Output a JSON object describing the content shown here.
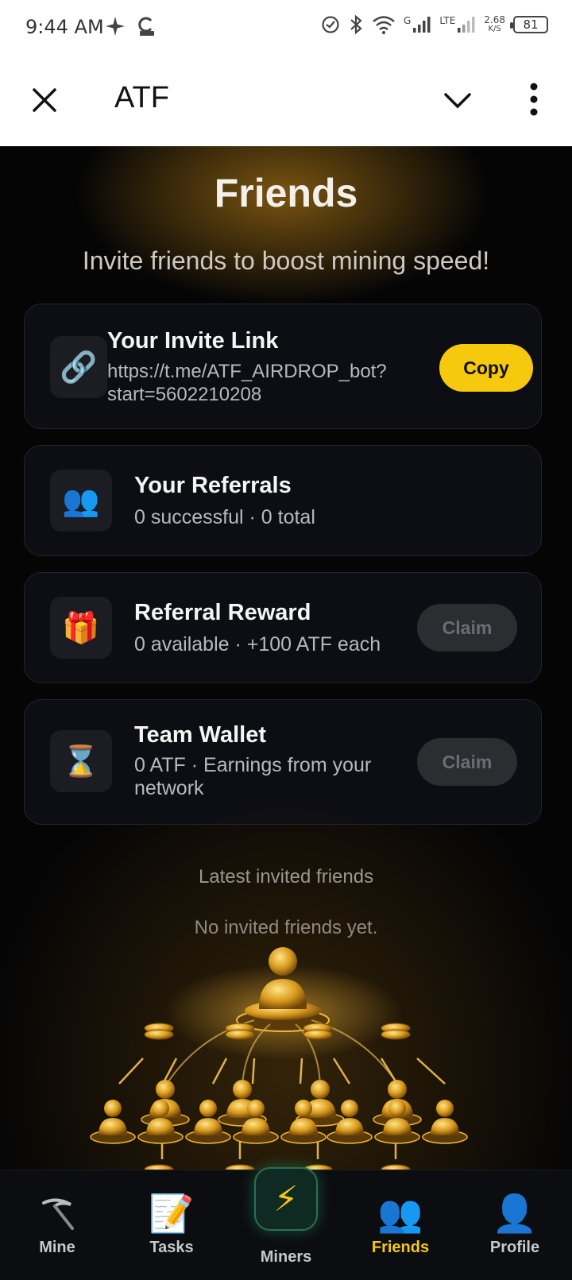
{
  "status_bar": {
    "time": "9:44 AM",
    "network_label": "G",
    "lte_label": "LTE",
    "speed_value": "2.68",
    "speed_unit": "K/S",
    "battery": "81"
  },
  "header": {
    "title": "ATF"
  },
  "page": {
    "title": "Friends",
    "subtitle": "Invite friends to boost mining speed!"
  },
  "cards": {
    "invite": {
      "icon": "link-icon",
      "title": "Your Invite Link",
      "link_line1": "https://t.me/ATF_AIRDROP_bot?",
      "link_line2": "start=5602210208",
      "button": "Copy"
    },
    "referrals": {
      "icon": "people-icon",
      "title": "Your Referrals",
      "sub": "0 successful · 0 total"
    },
    "reward": {
      "icon": "gift-icon",
      "title": "Referral Reward",
      "sub": "0 available · +100 ATF each",
      "button": "Claim"
    },
    "team_wallet": {
      "icon": "hourglass-icon",
      "title": "Team Wallet",
      "sub_line1": "0 ATF · Earnings from your",
      "sub_line2": "network",
      "button": "Claim"
    }
  },
  "latest_friends": {
    "label": "Latest invited friends",
    "empty_text": "No invited friends yet."
  },
  "bottom_nav": {
    "items": [
      {
        "label": "Mine",
        "icon": "pickaxe-icon"
      },
      {
        "label": "Tasks",
        "icon": "memo-icon"
      },
      {
        "label": "Miners",
        "icon": "lightning-icon"
      },
      {
        "label": "Friends",
        "icon": "people-icon",
        "active": true
      },
      {
        "label": "Profile",
        "icon": "person-icon"
      }
    ]
  },
  "colors": {
    "accent": "#f6c90e",
    "background": "#050506",
    "card": "#0e0f14"
  }
}
